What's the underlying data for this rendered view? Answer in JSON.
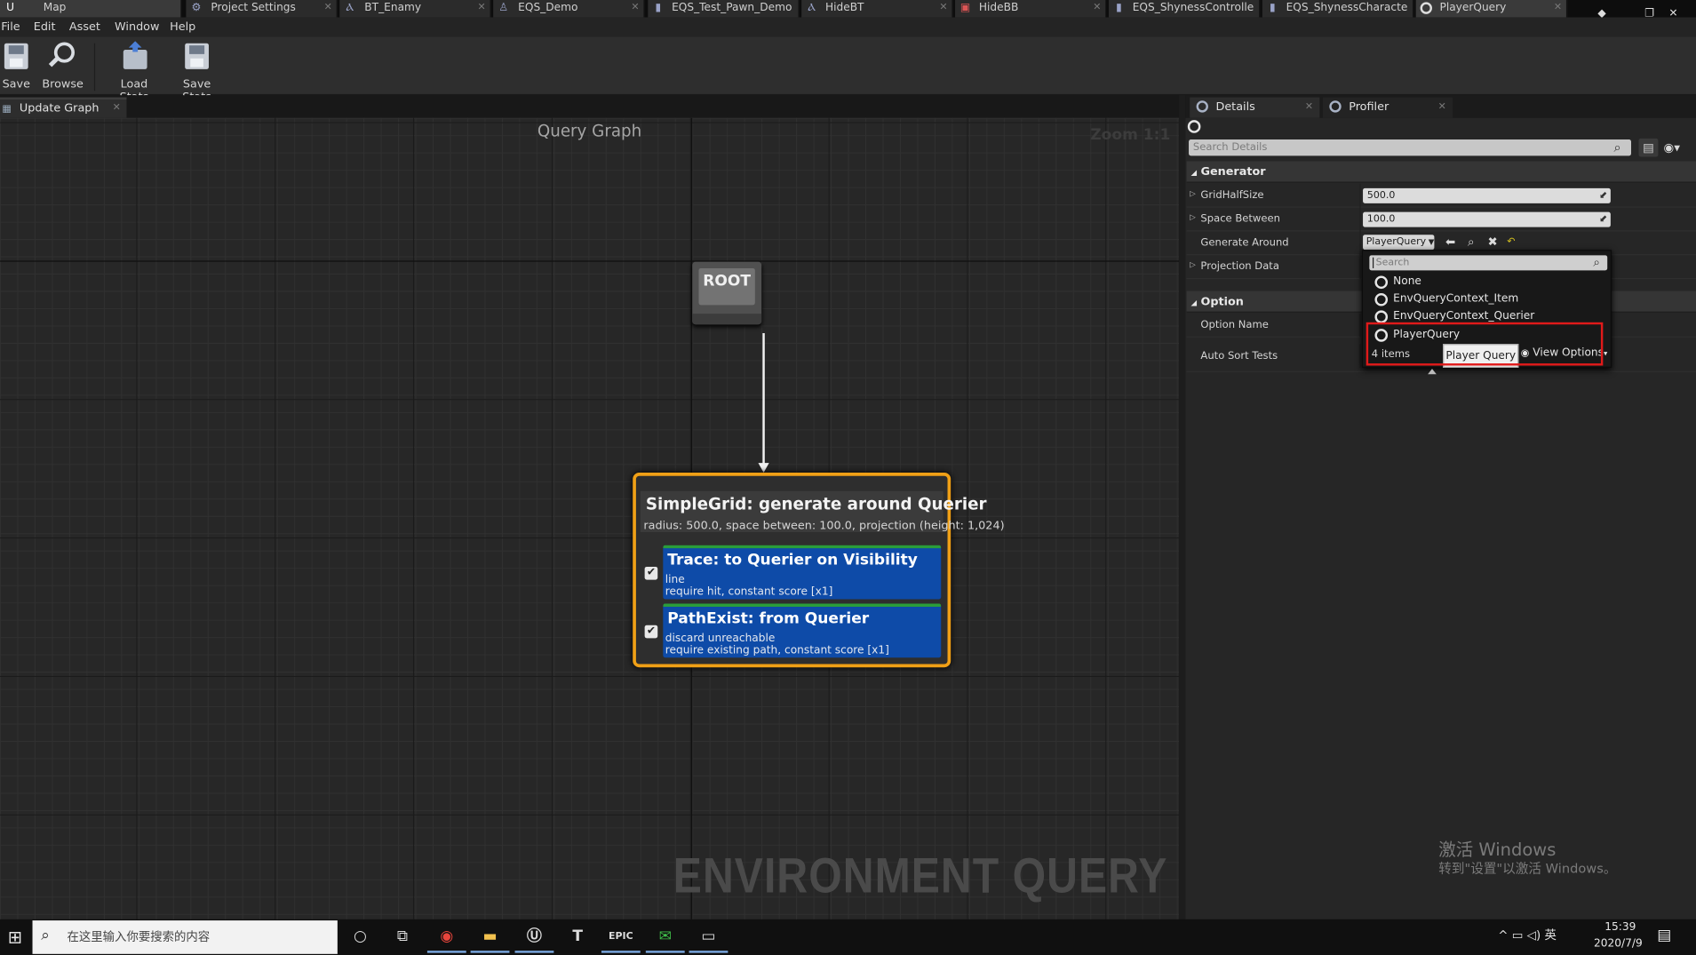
{
  "tabs": [
    {
      "label": "Map",
      "icon": "ue-logo-icon"
    },
    {
      "label": "Project Settings",
      "icon": "gear-icon"
    },
    {
      "label": "BT_Enamy",
      "icon": "behavior-tree-icon"
    },
    {
      "label": "EQS_Demo",
      "icon": "character-icon"
    },
    {
      "label": "EQS_Test_Pawn_Demo",
      "icon": "blueprint-icon"
    },
    {
      "label": "HideBT",
      "icon": "behavior-tree-icon"
    },
    {
      "label": "HideBB",
      "icon": "blackboard-icon"
    },
    {
      "label": "EQS_ShynessControlle",
      "icon": "blueprint-icon"
    },
    {
      "label": "EQS_ShynessCharacte",
      "icon": "blueprint-icon"
    },
    {
      "label": "PlayerQuery",
      "icon": "query-icon"
    }
  ],
  "menu": [
    "File",
    "Edit",
    "Asset",
    "Window",
    "Help"
  ],
  "toolbar": {
    "save": "Save",
    "browse": "Browse",
    "load_stats": "Load Stats",
    "save_stats": "Save Stats"
  },
  "graph": {
    "tab_label": "Update Graph",
    "title": "Query Graph",
    "zoom": "Zoom 1:1",
    "watermark": "ENVIRONMENT QUERY",
    "root_label": "ROOT",
    "main_node": {
      "title": "SimpleGrid: generate around Querier",
      "desc": "radius: 500.0, space between: 100.0, projection (height: 1,024)"
    },
    "tests": [
      {
        "title": "Trace: to Querier on Visibility",
        "line1": "line",
        "line2": "require hit, constant score [x1]",
        "checked": true
      },
      {
        "title": "PathExist: from Querier",
        "line1": "discard unreachable",
        "line2": "require existing path, constant score [x1]",
        "checked": true
      }
    ]
  },
  "details": {
    "tabs": [
      "Details",
      "Profiler"
    ],
    "search_placeholder": "Search Details",
    "categories": {
      "generator": "Generator",
      "option": "Option"
    },
    "rows": {
      "grid_half_size": {
        "label": "GridHalfSize",
        "value": "500.0"
      },
      "space_between": {
        "label": "Space Between",
        "value": "100.0"
      },
      "generate_around": {
        "label": "Generate Around",
        "value": "PlayerQuery"
      },
      "projection_data": {
        "label": "Projection Data"
      },
      "option_name": {
        "label": "Option Name"
      },
      "auto_sort_tests": {
        "label": "Auto Sort Tests"
      }
    }
  },
  "dropdown": {
    "search_placeholder": "Search",
    "items": [
      "None",
      "EnvQueryContext_Item",
      "EnvQueryContext_Querier",
      "PlayerQuery"
    ],
    "count": "4 items",
    "view_options": "View Options",
    "tooltip": "Player Query"
  },
  "watermark": {
    "line1": "激活 Windows",
    "line2": "转到\"设置\"以激活 Windows。"
  },
  "taskbar": {
    "search_placeholder": "在这里输入你要搜索的内容",
    "ime": "英",
    "time": "15:39",
    "date": "2020/7/9"
  },
  "colors": {
    "node_border": "#f0a016",
    "test_bg": "#0e4ba8",
    "highlight": "#e01a1a"
  }
}
